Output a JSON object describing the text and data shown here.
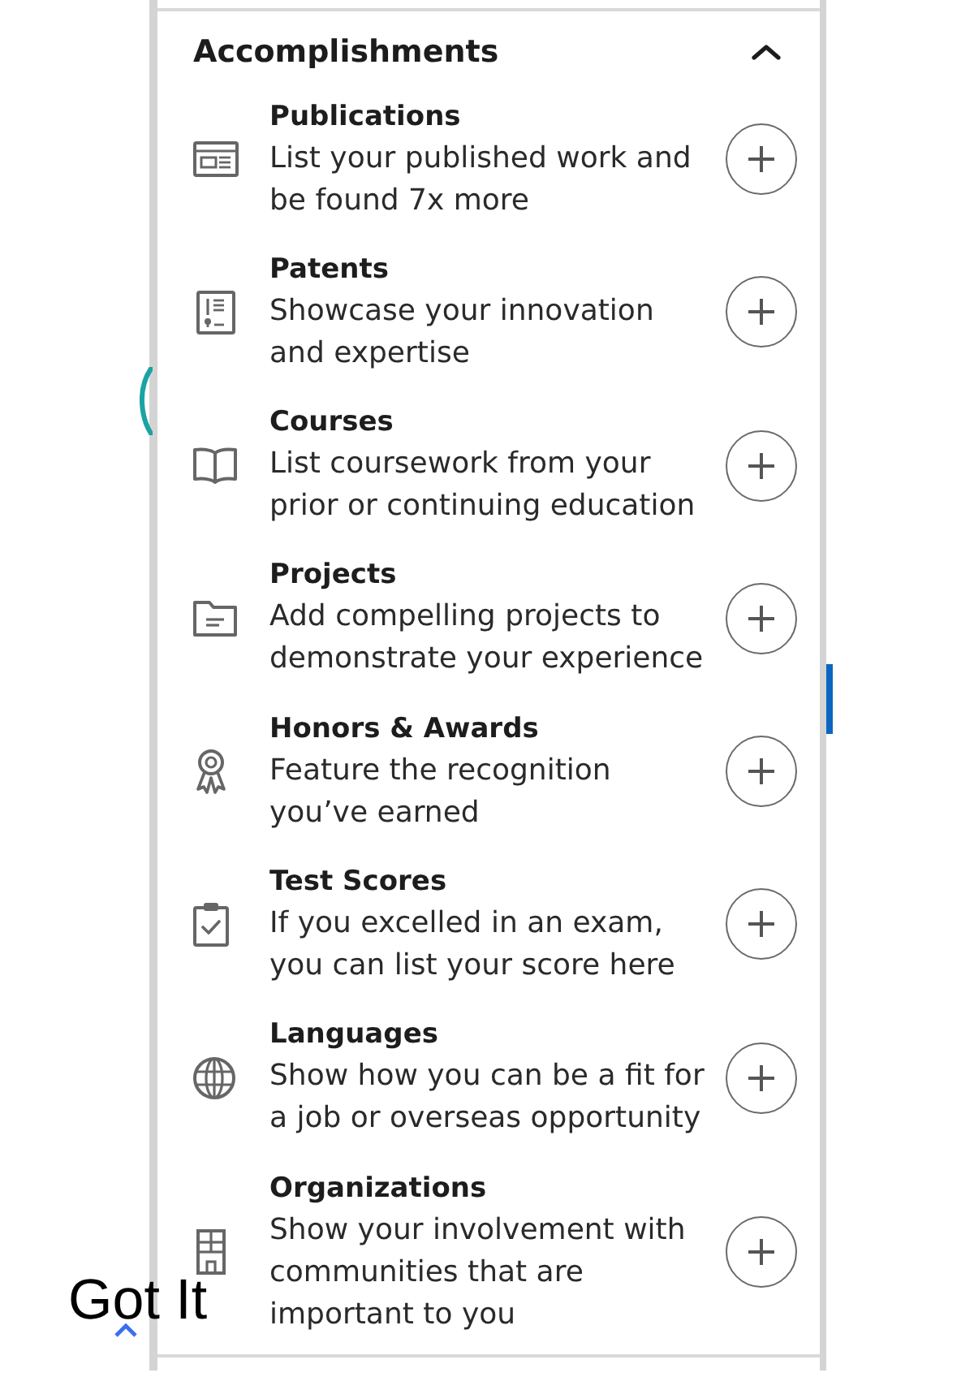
{
  "section": {
    "title": "Accomplishments",
    "expanded": true
  },
  "items": [
    {
      "title": "Publications",
      "description": "List your published work and be found 7x more"
    },
    {
      "title": "Patents",
      "description": "Showcase your innovation and expertise"
    },
    {
      "title": "Courses",
      "description": "List coursework from your prior or continuing education"
    },
    {
      "title": "Projects",
      "description": "Add compelling projects to demonstrate your experience"
    },
    {
      "title": "Honors & Awards",
      "description": "Feature the recognition you’ve earned"
    },
    {
      "title": "Test Scores",
      "description": "If you excelled in an exam, you can list your score here"
    },
    {
      "title": "Languages",
      "description": "Show how you can be a fit for a job or overseas opportunity"
    },
    {
      "title": "Organizations",
      "description": "Show your involvement with communities that are important to you"
    }
  ],
  "got_it": {
    "label": "Got It"
  }
}
